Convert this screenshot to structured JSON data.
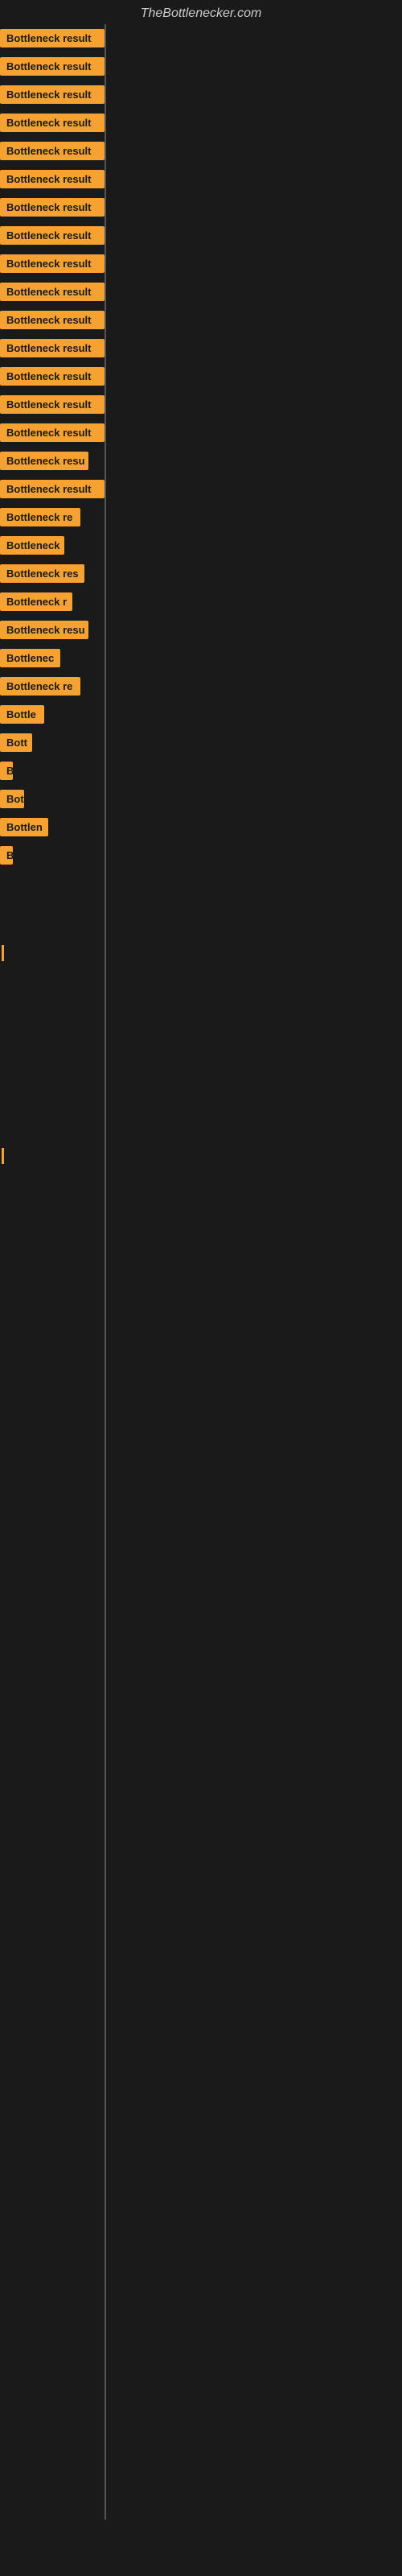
{
  "site": {
    "title": "TheBottlenecker.com"
  },
  "bars": [
    {
      "label": "Bottleneck result",
      "width": 130
    },
    {
      "label": "Bottleneck result",
      "width": 130
    },
    {
      "label": "Bottleneck result",
      "width": 130
    },
    {
      "label": "Bottleneck result",
      "width": 130
    },
    {
      "label": "Bottleneck result",
      "width": 130
    },
    {
      "label": "Bottleneck result",
      "width": 130
    },
    {
      "label": "Bottleneck result",
      "width": 130
    },
    {
      "label": "Bottleneck result",
      "width": 130
    },
    {
      "label": "Bottleneck result",
      "width": 130
    },
    {
      "label": "Bottleneck result",
      "width": 130
    },
    {
      "label": "Bottleneck result",
      "width": 130
    },
    {
      "label": "Bottleneck result",
      "width": 130
    },
    {
      "label": "Bottleneck result",
      "width": 130
    },
    {
      "label": "Bottleneck result",
      "width": 130
    },
    {
      "label": "Bottleneck result",
      "width": 130
    },
    {
      "label": "Bottleneck resu",
      "width": 110
    },
    {
      "label": "Bottleneck result",
      "width": 130
    },
    {
      "label": "Bottleneck re",
      "width": 100
    },
    {
      "label": "Bottleneck",
      "width": 80
    },
    {
      "label": "Bottleneck res",
      "width": 105
    },
    {
      "label": "Bottleneck r",
      "width": 90
    },
    {
      "label": "Bottleneck resu",
      "width": 110
    },
    {
      "label": "Bottlenec",
      "width": 75
    },
    {
      "label": "Bottleneck re",
      "width": 100
    },
    {
      "label": "Bottle",
      "width": 55
    },
    {
      "label": "Bott",
      "width": 40
    },
    {
      "label": "B",
      "width": 16
    },
    {
      "label": "Bot",
      "width": 30
    },
    {
      "label": "Bottlen",
      "width": 60
    },
    {
      "label": "B",
      "width": 16
    },
    {
      "label": "",
      "width": 0
    },
    {
      "label": "",
      "width": 0
    },
    {
      "label": "|",
      "width": 6
    },
    {
      "label": "",
      "width": 0
    },
    {
      "label": "",
      "width": 0
    },
    {
      "label": "",
      "width": 0
    },
    {
      "label": "",
      "width": 0
    },
    {
      "label": "",
      "width": 0
    },
    {
      "label": "|",
      "width": 6
    }
  ]
}
